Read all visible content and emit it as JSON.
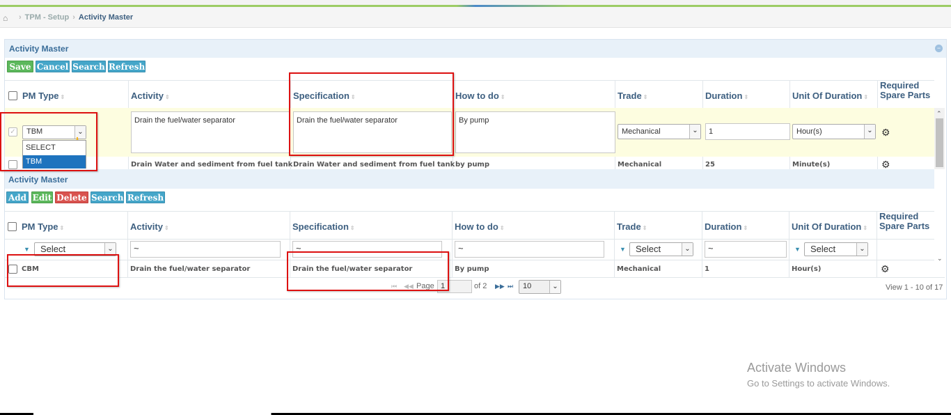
{
  "breadcrumb": {
    "home_icon": "home-icon",
    "items": [
      "TPM - Setup",
      "Activity Master"
    ]
  },
  "form_panel": {
    "title": "Activity Master",
    "buttons": {
      "save": "Save",
      "cancel": "Cancel",
      "search": "Search",
      "refresh": "Refresh"
    },
    "columns": [
      "PM Type",
      "Activity",
      "Specification",
      "How to do",
      "Trade",
      "Duration",
      "Unit Of Duration",
      "Required",
      "Spare Parts"
    ],
    "edit_row": {
      "pm_type": "TBM",
      "activity": "Drain the fuel/water separator",
      "specification": "Drain the fuel/water separator",
      "how_to_do": "By pump",
      "trade": "Mechanical",
      "duration": "1",
      "unit_of_duration": "Hour(s)"
    },
    "pm_type_options": [
      "SELECT",
      "TBM"
    ],
    "next_row": {
      "activity": "Drain Water and sediment from fuel tank",
      "specification": "Drain Water and sediment from fuel tank",
      "how_to_do": "by pump",
      "trade": "Mechanical",
      "duration": "25",
      "unit_of_duration": "Minute(s)"
    }
  },
  "grid_panel": {
    "title": "Activity Master",
    "buttons": {
      "add": "Add",
      "edit": "Edit",
      "delete": "Delete",
      "search": "Search",
      "refresh": "Refresh"
    },
    "columns": [
      "PM Type",
      "Activity",
      "Specification",
      "How to do",
      "Trade",
      "Duration",
      "Unit Of Duration",
      "Required",
      "Spare Parts"
    ],
    "filters": {
      "pm_type": "Select",
      "activity": "~",
      "specification": "~",
      "how_to_do": "~",
      "trade": "Select",
      "duration": "~",
      "unit_of_duration": "Select"
    },
    "row": {
      "pm_type": "CBM",
      "activity": "Drain the fuel/water separator",
      "specification": "Drain the fuel/water separator",
      "how_to_do": "By pump",
      "trade": "Mechanical",
      "duration": "1",
      "unit_of_duration": "Hour(s)"
    },
    "pager": {
      "page_label": "Page",
      "page_value": "1",
      "of_label": "of 2",
      "rows": "10",
      "view": "View 1 - 10 of 17"
    }
  },
  "watermark": {
    "line1": "Activate Windows",
    "line2": "Go to Settings to activate Windows."
  }
}
